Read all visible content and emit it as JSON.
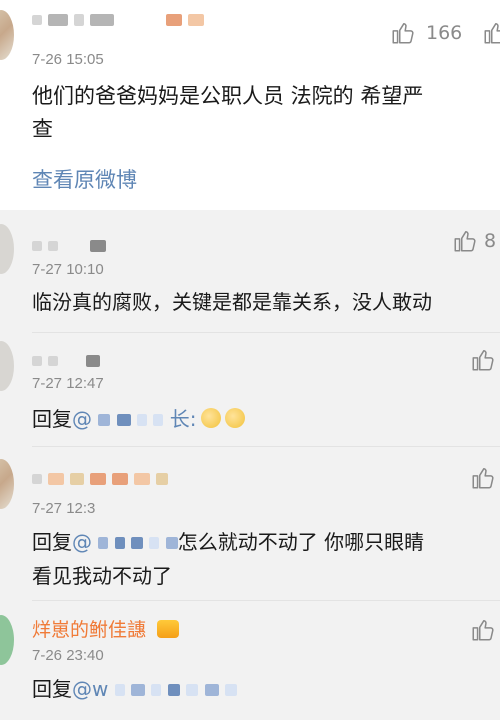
{
  "main_comment": {
    "time": "7-26 15:05",
    "likes": "166",
    "line1": "他们的爸爸妈妈是公职人员 法院的 希望严",
    "line2": "查",
    "view_original": "查看原微博"
  },
  "sub_comments": [
    {
      "time": "7-27 10:10",
      "likes": "8",
      "text": "临汾真的腐败，关键是都是靠关系，没人敢动"
    },
    {
      "time": "7-27 12:47",
      "reply_prefix": "回复",
      "mention": "@",
      "mention_suffix": "长:"
    },
    {
      "time": "7-27 12:3",
      "reply_prefix": "回复",
      "mention": "@",
      "text_after": "怎么就动不动了 你哪只眼睛",
      "line2": "看见我动不动了"
    },
    {
      "username": "烊崽的鲋佳譓",
      "time": "7-26 23:40",
      "reply_prefix": "回复",
      "mention": "@w"
    }
  ],
  "colors": {
    "link": "#5f86b5",
    "vip_name": "#f07b38",
    "time": "#8a8a8a",
    "sub_bg": "#f2f2f2"
  },
  "icons": [
    "thumbs-up-icon",
    "crown-icon",
    "emoji-icon"
  ]
}
